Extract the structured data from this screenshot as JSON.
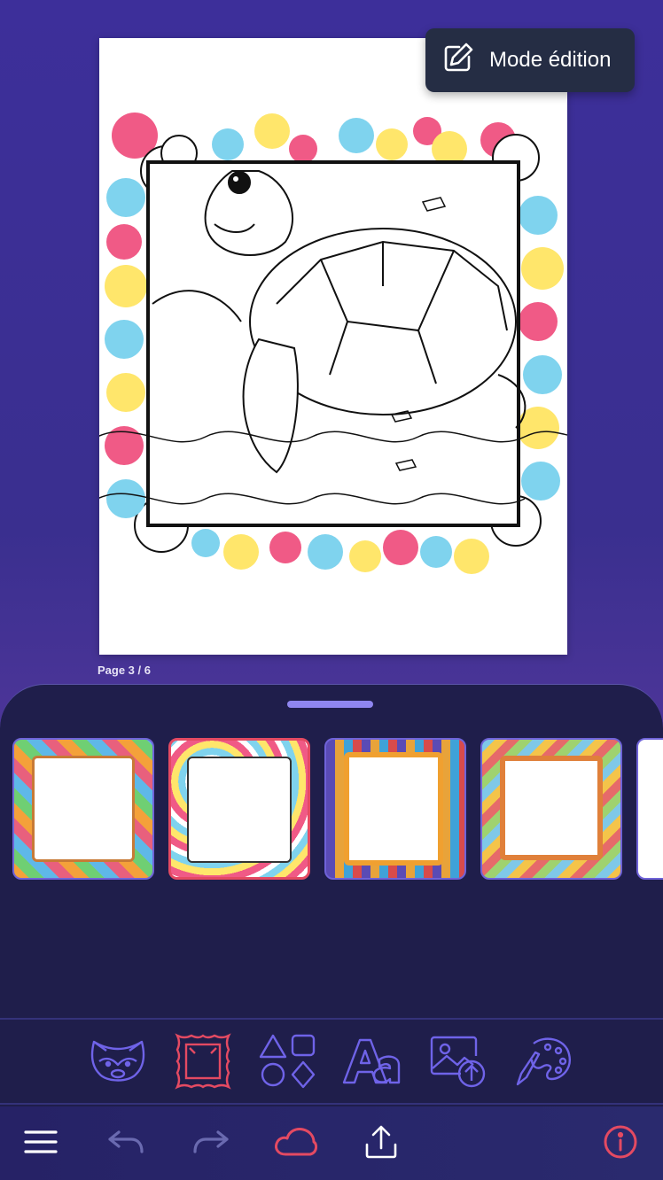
{
  "editor": {
    "mode_button_label": "Mode édition",
    "page_indicator": "Page 3 / 6"
  },
  "icons": {
    "edit": "pencil-square-icon",
    "stickers": "raccoon-icon",
    "frames": "frame-icon",
    "shapes": "shapes-icon",
    "text": "text-icon",
    "image_upload": "image-upload-icon",
    "palette": "palette-icon",
    "menu": "menu-icon",
    "undo": "undo-icon",
    "redo": "redo-icon",
    "cloud": "cloud-icon",
    "share": "share-icon",
    "info": "info-icon"
  },
  "frames": [
    {
      "name": "frame-emoji",
      "selected": false
    },
    {
      "name": "frame-doodle",
      "selected": true
    },
    {
      "name": "frame-stickers",
      "selected": false
    },
    {
      "name": "frame-rainbow",
      "selected": false
    }
  ],
  "colors": {
    "accent": "#e44a62",
    "tool_icon": "#6f63e8",
    "panel_bg": "#1f1e4b"
  }
}
